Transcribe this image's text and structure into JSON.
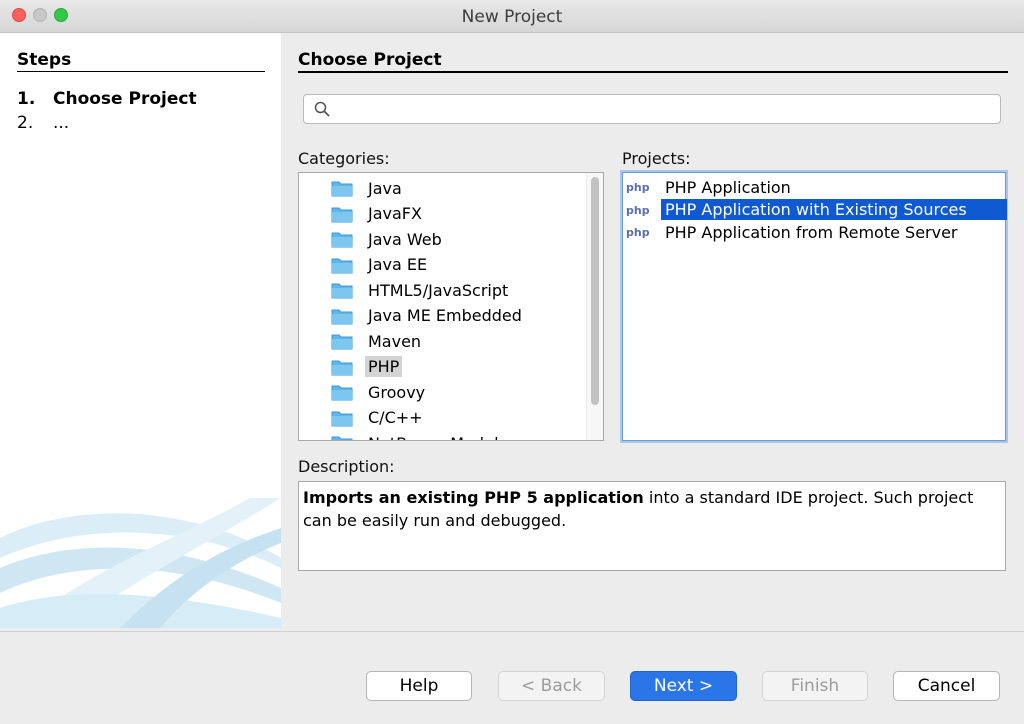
{
  "window": {
    "title": "New Project"
  },
  "steps": {
    "title": "Steps",
    "items": [
      {
        "num": "1.",
        "label": "Choose Project"
      },
      {
        "num": "2.",
        "label": "..."
      }
    ]
  },
  "panel": {
    "title": "Choose Project"
  },
  "search": {
    "value": "",
    "placeholder": ""
  },
  "categories": {
    "label": "Categories:",
    "items": [
      "Java",
      "JavaFX",
      "Java Web",
      "Java EE",
      "HTML5/JavaScript",
      "Java ME Embedded",
      "Maven",
      "PHP",
      "Groovy",
      "C/C++",
      "NetBeans Modules"
    ],
    "selected": "PHP"
  },
  "projects": {
    "label": "Projects:",
    "items": [
      "PHP Application",
      "PHP Application with Existing Sources",
      "PHP Application from Remote Server"
    ],
    "selected": "PHP Application with Existing Sources"
  },
  "description": {
    "label": "Description:",
    "bold": "Imports an existing PHP 5 application",
    "text": " into a standard IDE project. Such project can be easily run and debugged."
  },
  "buttons": {
    "help": "Help",
    "back": "< Back",
    "next": "Next >",
    "finish": "Finish",
    "cancel": "Cancel"
  },
  "colors": {
    "selection": "#0f59d2",
    "default_button": "#2a76e8",
    "folder": "#5fb6ea"
  }
}
